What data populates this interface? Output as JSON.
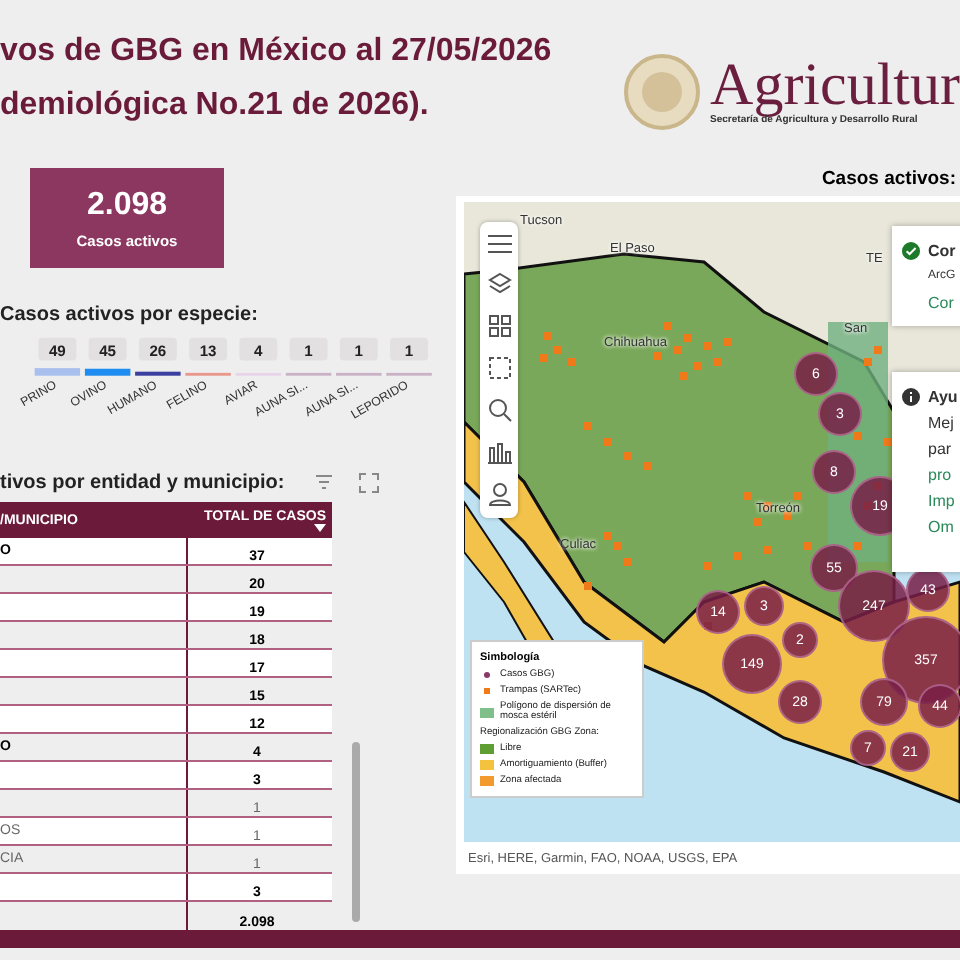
{
  "header": {
    "title_lines": [
      "vos de GBG en México al 27/05/2026",
      "demiológica No.21 de 2026)."
    ],
    "logo": {
      "name": "Agricultur",
      "subtitle": "Secretaría de Agricultura y Desarrollo Rural"
    }
  },
  "kpi": {
    "value": "2.098",
    "label": "Casos activos"
  },
  "species": {
    "title": "Casos activos por especie:",
    "chart_data": {
      "type": "bar",
      "categories": [
        "PRINO",
        "OVINO",
        "HUMANO",
        "FELINO",
        "AVIAR",
        "AUNA SI...",
        "AUNA SI...",
        "LEPORIDO"
      ],
      "values": [
        49,
        45,
        26,
        13,
        4,
        1,
        1,
        1
      ],
      "colors": [
        "#a9c0ef",
        "#1e8cf0",
        "#3b3f9f",
        "#e8978a",
        "#e9d3e8",
        "#c9b2c6",
        "#c9b2c6",
        "#c9b2c6"
      ],
      "data_labels": true
    }
  },
  "table": {
    "title": "tivos por entidad y municipio:",
    "columns": [
      "/MUNICIPIO",
      "TOTAL DE CASOS"
    ],
    "rows": [
      {
        "kind": "entity",
        "name": "O",
        "total": "37"
      },
      {
        "kind": "entity",
        "total": "20"
      },
      {
        "kind": "entity",
        "total": "19"
      },
      {
        "kind": "entity",
        "total": "18"
      },
      {
        "kind": "entity",
        "total": "17"
      },
      {
        "kind": "entity",
        "total": "15"
      },
      {
        "kind": "entity",
        "total": "12"
      },
      {
        "kind": "entity",
        "name": "O",
        "total": "4"
      },
      {
        "kind": "entity",
        "total": "3"
      },
      {
        "kind": "municipality",
        "total": "1"
      },
      {
        "kind": "municipality",
        "name": "OS",
        "total": "1"
      },
      {
        "kind": "municipality",
        "name": "CIA",
        "total": "1"
      },
      {
        "kind": "entity",
        "total": "3"
      },
      {
        "kind": "total",
        "total": "2.098"
      }
    ]
  },
  "map": {
    "title": "Casos activos:",
    "places": [
      "Tucson",
      "El Paso",
      "Chihuahua",
      "Culiac",
      "Torreón",
      "San",
      "TE"
    ],
    "clusters": [
      "6",
      "3",
      "8",
      "19",
      "55",
      "247",
      "43",
      "14",
      "3",
      "2",
      "149",
      "357",
      "28",
      "79",
      "44",
      "7",
      "21"
    ],
    "popups": [
      {
        "kind": "ok",
        "lines": [
          {
            "text": "Cor",
            "kind": "title"
          },
          {
            "text": "ArcG",
            "kind": "small"
          },
          {
            "text": "Cor",
            "kind": "link"
          }
        ]
      },
      {
        "kind": "info",
        "lines": [
          {
            "text": "Ayu",
            "kind": "title"
          },
          {
            "text": "Mej",
            "kind": "body"
          },
          {
            "text": "par",
            "kind": "body"
          },
          {
            "text": "pro",
            "kind": "link"
          },
          {
            "text": "Imp",
            "kind": "link"
          },
          {
            "text": "Om",
            "kind": "link"
          }
        ]
      }
    ],
    "legend": {
      "title": "Simbología",
      "items": [
        {
          "kind": "dot",
          "label": "Casos GBG)",
          "color": "#8a3a6a"
        },
        {
          "kind": "square",
          "label": "Trampas (SARTec)",
          "color": "#f07a1a"
        },
        {
          "kind": "swatch",
          "label": "Polígono de dispersión de mosca estéril",
          "color": "#7fbf8a"
        }
      ],
      "zone_title": "Regionalización GBG Zona:",
      "zones": [
        {
          "label": "Libre",
          "color": "#5e9e32"
        },
        {
          "label": "Amortiguamiento (Buffer)",
          "color": "#f5c23e"
        },
        {
          "label": "Zona afectada",
          "color": "#f29a2e"
        }
      ]
    },
    "attribution": "Esri, HERE, Garmin, FAO, NOAA, USGS, EPA"
  }
}
